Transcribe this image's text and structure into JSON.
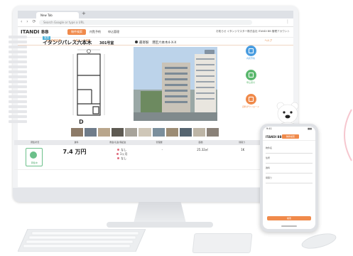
{
  "browser": {
    "tab_title": "New Tab",
    "tab_plus": "+",
    "nav_glyphs": "‹ › ⟳",
    "url_placeholder": "Search Google or type a URL",
    "menu": "⋮"
  },
  "app": {
    "logo": "ITANDI BB",
    "logo_sub": "",
    "nav": [
      "物件検索",
      "内覧予約",
      "申込管理"
    ],
    "header_right": "お知らせ  イタンジマスター株式会社 ITANDI BB 管理アカウント",
    "subtabs": [
      "物件検索結果",
      "お気に入り物件"
    ],
    "help": "ヘルプ"
  },
  "property": {
    "badge": "賃貸",
    "name": "イタンジパレス六本木",
    "room": "301号室",
    "station": "最寄駅　港区六本木4-X-X"
  },
  "actions": [
    {
      "label": "内見予約",
      "color": "#4a9de0"
    },
    {
      "label": "申込受付",
      "color": "#5bb86e"
    },
    {
      "label": "資料ダウンロード",
      "color": "#f08a4b"
    }
  ],
  "table": {
    "headers": [
      "募集状況",
      "賃料",
      "敷金/礼金/保証金",
      "管理費",
      "面積",
      "間取り"
    ],
    "rent_label": "募集中",
    "price": "7.4 万円",
    "fees": [
      "なし",
      "1ヶ月",
      "なし"
    ],
    "area": "25.32㎡",
    "layout": "1K"
  },
  "phone": {
    "time": "9:41",
    "logo": "ITANDI BB",
    "tab": "物件検索",
    "labels": [
      "物件名",
      "住所",
      "賃料",
      "間取り"
    ],
    "button": "検索"
  },
  "colors": {
    "accent": "#f08a4b",
    "green": "#5bb86e",
    "blue": "#4a9de0"
  }
}
